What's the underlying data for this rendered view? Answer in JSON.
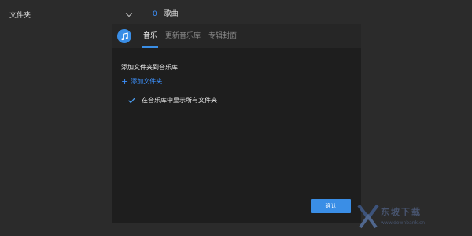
{
  "topbar": {
    "folder_label": "文件夹",
    "song_count": "0",
    "song_unit": "歌曲"
  },
  "dialog": {
    "tabs": [
      {
        "label": "音乐",
        "active": true
      },
      {
        "label": "更新音乐库",
        "active": false
      },
      {
        "label": "专辑封面",
        "active": false
      }
    ],
    "section_title": "添加文件夹到音乐库",
    "add_folder_label": "添加文件夹",
    "show_all_label": "在音乐库中显示所有文件夹",
    "show_all_checked": true,
    "confirm_label": "确认"
  },
  "watermark": {
    "text": "东坡下载",
    "url": "www.downbank.cn"
  },
  "colors": {
    "accent": "#3a8ee6",
    "link": "#3d92ff",
    "dialog_bg": "#1e1e1e",
    "page_bg": "#2b2b2b"
  },
  "icons": [
    "music-note-icon",
    "chevron-down-icon",
    "plus-icon",
    "check-icon"
  ]
}
